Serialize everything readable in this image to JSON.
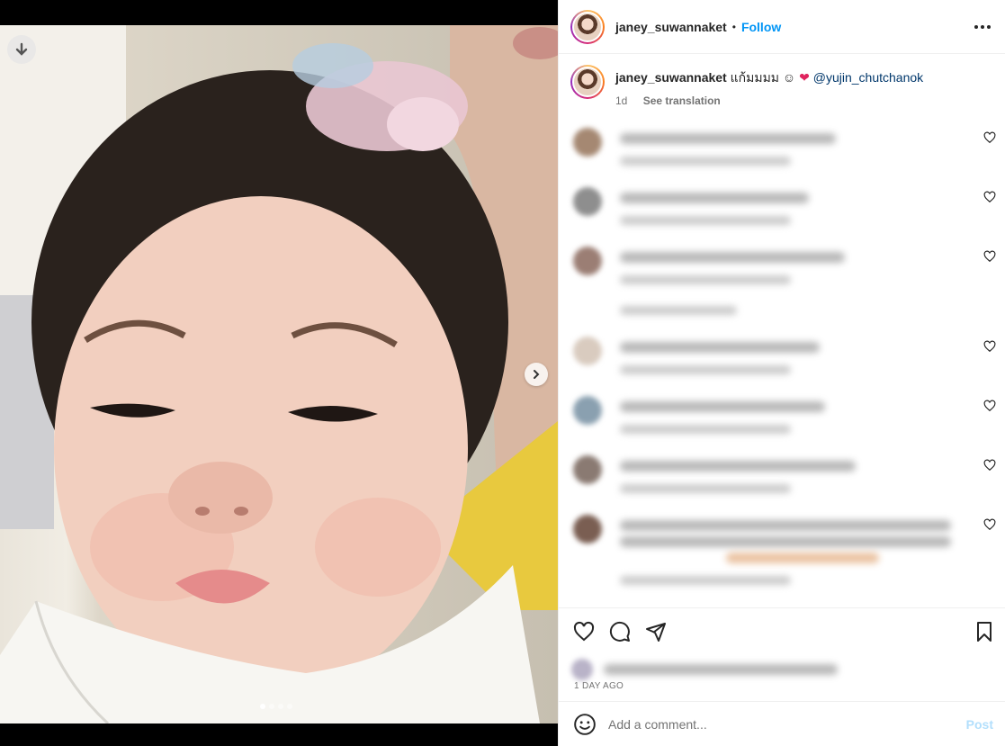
{
  "post": {
    "username": "janey_suwannaket",
    "separator": "•",
    "follow_label": "Follow",
    "more_icon": "more-horizontal-icon"
  },
  "caption": {
    "username": "janey_suwannaket",
    "text": " แก้มมมม ☺",
    "emoji": "❤",
    "mention": "@yujin_chutchanok",
    "age": "1d",
    "see_translation": "See translation"
  },
  "media": {
    "download_icon": "download-arrow-icon",
    "next_icon": "chevron-right-icon",
    "carousel_count": 4,
    "carousel_active": 1
  },
  "actions": {
    "like_icon": "heart-icon",
    "comment_icon": "comment-bubble-icon",
    "share_icon": "paper-plane-icon",
    "save_icon": "bookmark-icon"
  },
  "timestamp": "1 DAY AGO",
  "add_comment": {
    "placeholder": "Add a comment...",
    "post_label": "Post",
    "emoji_icon": "smiley-face-icon"
  },
  "colors": {
    "follow_blue": "#0095f6",
    "post_disabled": "#b2dffc",
    "mention": "#00376b"
  }
}
